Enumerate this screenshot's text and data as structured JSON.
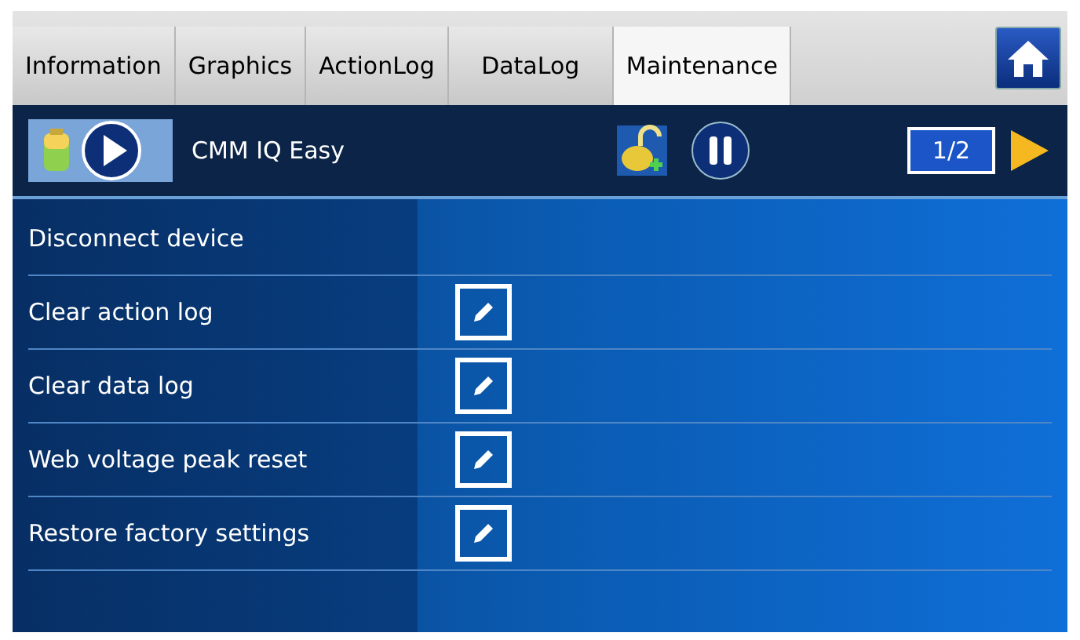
{
  "tabs": [
    {
      "label": "Information",
      "selected": false
    },
    {
      "label": "Graphics",
      "selected": false
    },
    {
      "label": "ActionLog",
      "selected": false
    },
    {
      "label": "DataLog",
      "selected": false
    },
    {
      "label": "Maintenance",
      "selected": true
    }
  ],
  "header": {
    "device": "CMM IQ Easy",
    "page": "1/2"
  },
  "rows": [
    {
      "label": "Disconnect device",
      "kind": "plain"
    },
    {
      "label": "Clear action log",
      "kind": "edit"
    },
    {
      "label": "Clear data log",
      "kind": "edit"
    },
    {
      "label": "Web voltage peak reset",
      "kind": "edit"
    },
    {
      "label": "Restore factory settings",
      "kind": "edit"
    }
  ]
}
